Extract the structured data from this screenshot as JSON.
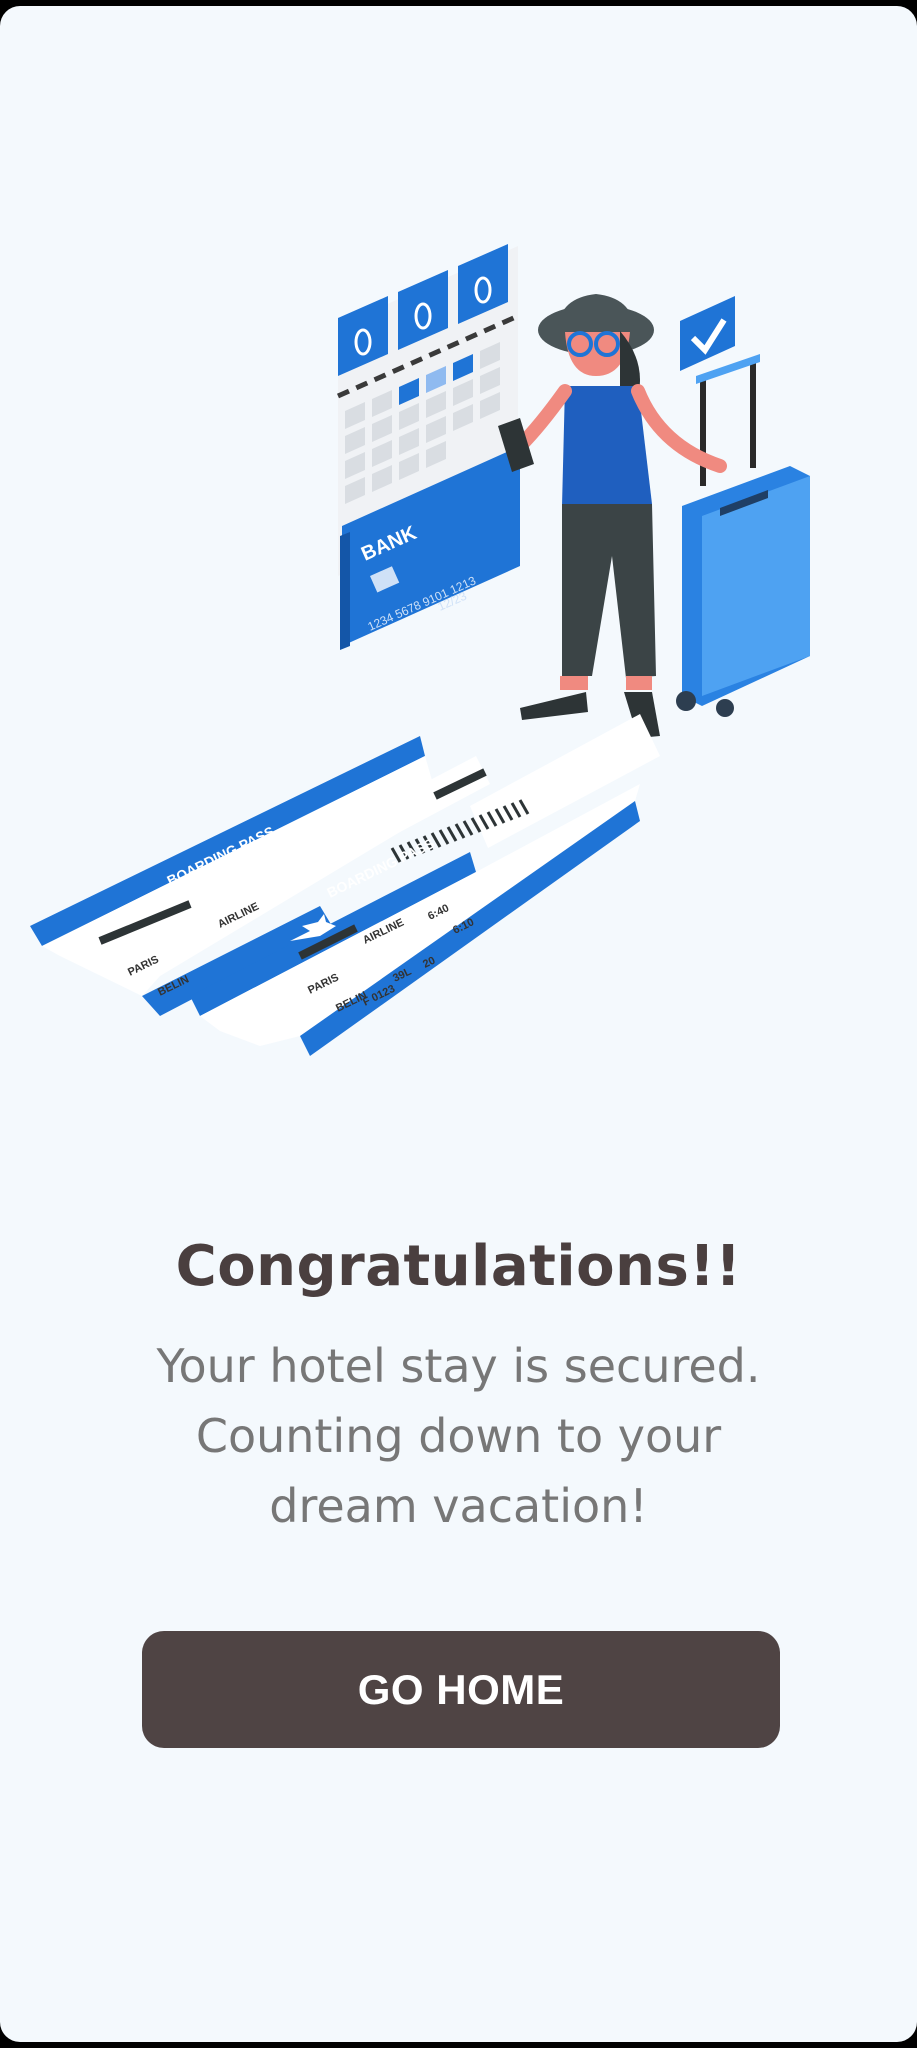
{
  "colors": {
    "background": "#f4f9fd",
    "accent_blue": "#1f74d6",
    "button": "#4f4444",
    "title": "#4a3f3f",
    "body_text": "#777777"
  },
  "illustration": {
    "card_brand": "BANK",
    "card_number": "1234 5678 9101 1213",
    "card_expiry": "12/23",
    "ticket_header": "BOARDING PASS",
    "ticket_airline": "AIRLINE",
    "ticket_from": "PARIS",
    "ticket_to": "BELIN",
    "ticket_flight": "F 0123",
    "ticket_time": "6:40",
    "ticket_gate": "20",
    "ticket_seat": "39L",
    "ticket_boarding": "6:10"
  },
  "content": {
    "title": "Congratulations!!",
    "message": "Your hotel stay is secured. Counting down to your dream vacation!"
  },
  "button": {
    "label": "GO HOME"
  }
}
